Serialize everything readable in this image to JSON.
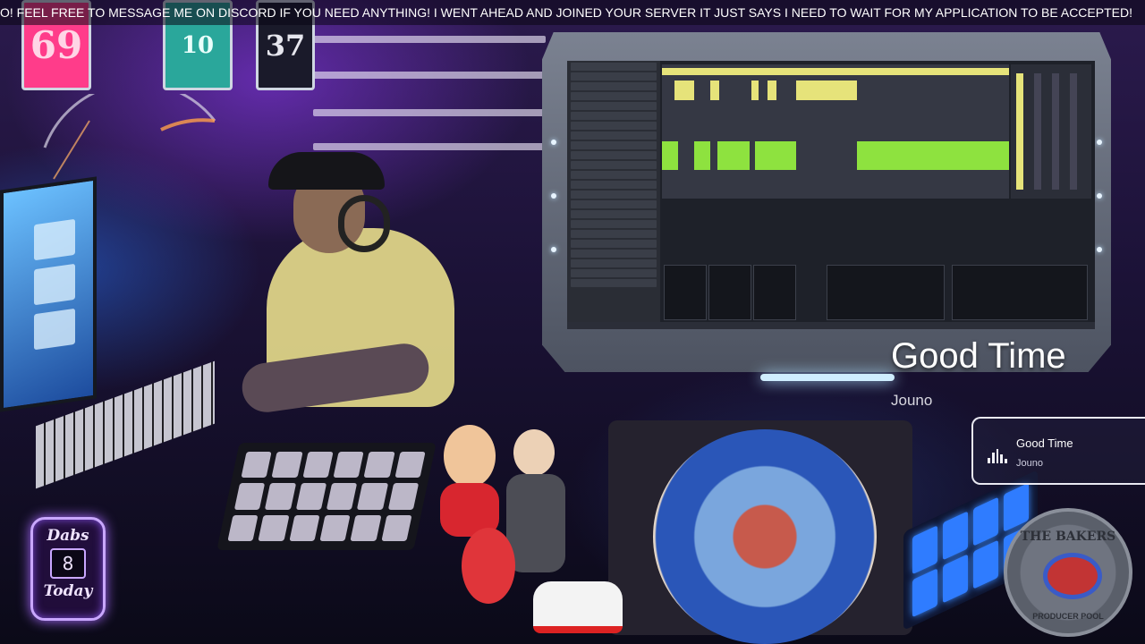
{
  "ticker": {
    "text": "O! FEEL FREE TO MESSAGE ME ON DISCORD IF YOU NEED ANYTHING! I WENT AHEAD AND JOINED YOUR SERVER IT JUST SAYS I NEED TO WAIT FOR MY APPLICATION TO BE ACCEPTED!"
  },
  "jerseys": [
    {
      "number": "69",
      "color": "#ff3c8a"
    },
    {
      "number": "10",
      "color": "#2aa79b"
    },
    {
      "number": "37",
      "color": "#1a1a2a"
    }
  ],
  "now_playing": {
    "title": "Good Time",
    "artist": "Jouno"
  },
  "now_playing_card": {
    "title": "Good Time",
    "artist": "Jouno",
    "icon": "equalizer-bars-icon"
  },
  "dabs_counter": {
    "line1": "Dabs",
    "count": "8",
    "line3": "Today"
  },
  "logo": {
    "top": "THE BAKERS",
    "bottom": "PRODUCER POOL"
  },
  "colors": {
    "accent_purple": "#a86bff",
    "daw_clip_yellow": "#e6e37a",
    "daw_clip_green": "#8ee23f"
  }
}
